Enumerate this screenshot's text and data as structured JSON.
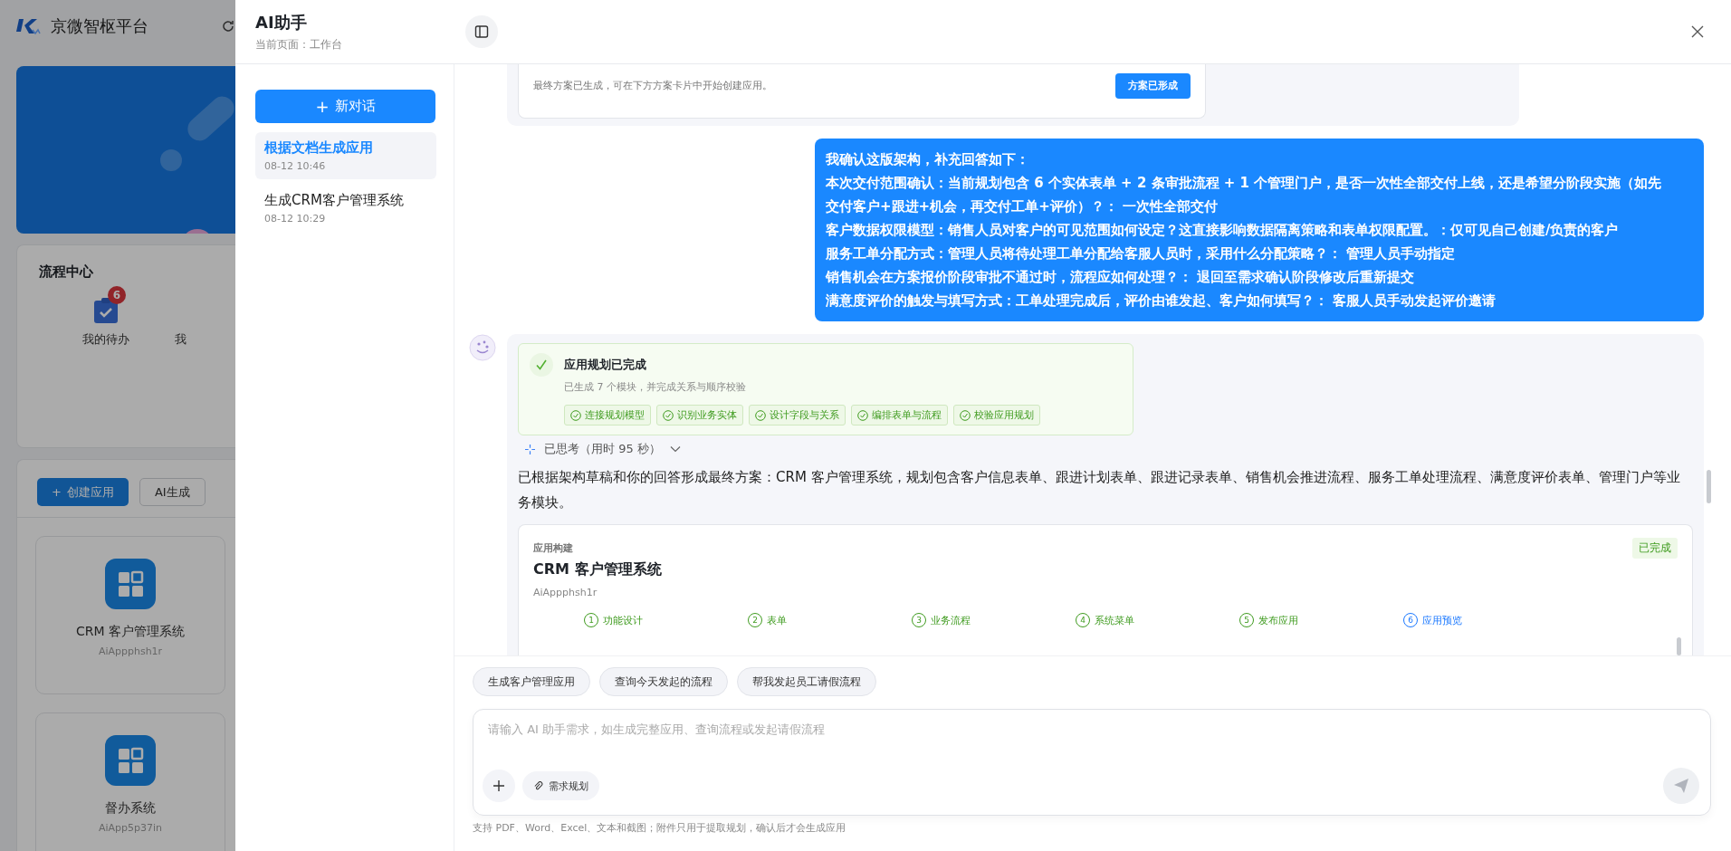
{
  "background_page": {
    "brand": "京微智枢平台",
    "process_center": {
      "title": "流程中心",
      "items": [
        {
          "label": "我的待办",
          "badge": "6"
        },
        {
          "label": "我"
        }
      ]
    },
    "toolbar": [
      {
        "label": "创建应用",
        "icon": "+",
        "kind": "primary"
      },
      {
        "label": "AI生成",
        "kind": "default"
      }
    ],
    "apps": [
      {
        "name": "CRM 客户管理系统",
        "code": "AiAppphsh1r"
      },
      {
        "name": "督办系统",
        "code": "AiApp5p37in"
      }
    ]
  },
  "drawer": {
    "title": "AI助手",
    "subtitle": "当前页面：工作台"
  },
  "sidebar": {
    "new_chat_icon": "+",
    "new_chat": "新对话",
    "conversations": [
      {
        "title": "根据文档生成应用",
        "time": "08-12 10:46",
        "selected": true
      },
      {
        "title": "生成CRM客户管理系统",
        "time": "08-12 10:29",
        "selected": false
      }
    ]
  },
  "messages": [
    {
      "kind": "final_notice",
      "text": "最终方案已生成，可在下方方案卡片中开始创建应用。",
      "button": "方案已形成"
    },
    {
      "kind": "user_text",
      "lines": [
        "我确认这版架构，补充回答如下：",
        "本次交付范围确认：当前规划包含 6 个实体表单 + 2 条审批流程 + 1 个管理门户，是否一次性全部交付上线，还是希望分阶段实施（如先交付客户+跟进+机会，再交付工单+评价）？： 一次性全部交付",
        "客户数据权限模型：销售人员对客户的可见范围如何设定？这直接影响数据隔离策略和表单权限配置。：仅可见自己创建/负责的客户",
        "服务工单分配方式：管理人员将待处理工单分配给客服人员时，采用什么分配策略？： 管理人员手动指定",
        "销售机会在方案报价阶段审批不通过时，流程应如何处理？： 退回至需求确认阶段修改后重新提交",
        "满意度评价的触发与填写方式：工单处理完成后，评价由谁发起、客户如何填写？： 客服人员手动发起评价邀请"
      ]
    },
    {
      "kind": "plan",
      "plan": {
        "title": "应用规划已完成",
        "subtitle": "已生成 7 个模块，并完成关系与顺序校验",
        "steps": [
          {
            "label": "连接规划模型",
            "done": true
          },
          {
            "label": "识别业务实体",
            "done": true
          },
          {
            "label": "设计字段与关系",
            "done": true
          },
          {
            "label": "编排表单与流程",
            "done": true
          },
          {
            "label": "校验应用规划",
            "done": true
          }
        ]
      },
      "thinking": "已思考（用时 95 秒）",
      "expanded": false,
      "text": "已根据架构草稿和你的回答形成最终方案：CRM 客户管理系统，规划包含客户信息表单、跟进计划表单、跟进记录表单、销售机会推进流程、服务工单处理流程、满意度评价表单、管理门户等业务模块。",
      "build": {
        "label": "应用构建",
        "status": "已完成",
        "name": "CRM 客户管理系统",
        "code": "AiAppphsh1r",
        "steps": [
          {
            "number": "1",
            "label": "功能设计",
            "done": true
          },
          {
            "number": "2",
            "label": "表单",
            "done": true
          },
          {
            "number": "3",
            "label": "业务流程",
            "done": true
          },
          {
            "number": "4",
            "label": "系统菜单",
            "done": true
          },
          {
            "number": "5",
            "label": "发布应用",
            "done": true
          },
          {
            "number": "6",
            "label": "应用预览",
            "done": false
          }
        ]
      }
    }
  ],
  "suggestions": [
    "生成客户管理应用",
    "查询今天发起的流程",
    "帮我发起员工请假流程"
  ],
  "composer": {
    "placeholder": "请输入 AI 助手需求，如生成完整应用、查询流程或发起请假流程",
    "attach_chip": "需求规划",
    "send_disabled": true,
    "hint": "支持 PDF、Word、Excel、文本和截图；附件只用于提取规划，确认后才会生成应用"
  }
}
